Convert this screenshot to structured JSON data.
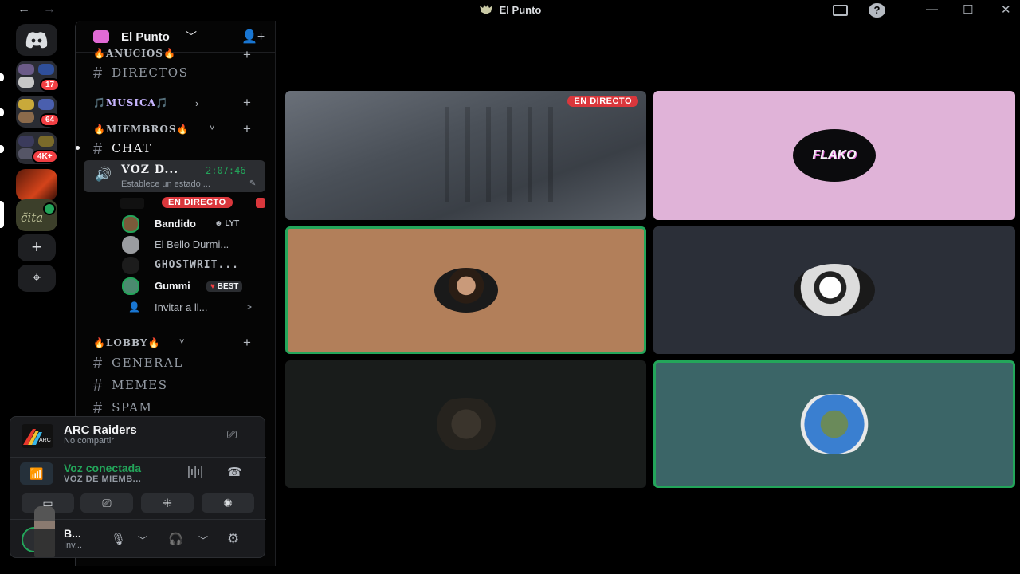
{
  "window": {
    "title": "El Punto",
    "back_icon": "arrow-left-icon",
    "forward_icon": "arrow-right-icon",
    "minimize_glyph": "—",
    "maximize_glyph": "☐",
    "close_glyph": "✕",
    "help_glyph": "?"
  },
  "rail": {
    "badges": [
      "17",
      "64",
      "4K+"
    ],
    "add_glyph": "+",
    "explore_glyph": "⌖"
  },
  "server": {
    "name": "El Punto",
    "chevron": "﹀"
  },
  "categories": [
    {
      "label": "🔥ANUCIOS🔥",
      "chevron": "˅",
      "plus": "+"
    },
    {
      "label": "🎵MUSICA🎵",
      "chevron": "›",
      "plus": "+"
    },
    {
      "label": "🔥MIEMBROS🔥",
      "chevron": "˅",
      "plus": "+"
    },
    {
      "label": "🔥LOBBY🔥",
      "chevron": "˅",
      "plus": "+"
    }
  ],
  "channels": {
    "hash": "#",
    "directos": "DIRECTOS",
    "chat": "CHAT",
    "general": "GENERAL",
    "memes": "MEMES",
    "spam": "SPAM"
  },
  "voice_channel": {
    "name": "VOZ D...",
    "elapsed": "2:07:46",
    "status_placeholder": "Establece un estado ...",
    "live_label": "EN DIRECTO",
    "users": [
      {
        "name": "Bandido",
        "badge": "LYT"
      },
      {
        "name": "El Bello Durmi..."
      },
      {
        "name": "GHOSTWRIT..."
      },
      {
        "name": "Gummi",
        "badge": "BEST"
      }
    ],
    "invite": "Invitar a ll...",
    "invite_chevron": ">"
  },
  "panel": {
    "activity_title": "ARC Raiders",
    "activity_sub": "No compartir",
    "rtc_title": "Voz conectada",
    "rtc_sub": "VOZ DE MIEMB...",
    "user_name": "B...",
    "user_sub": "Inv..."
  },
  "stage": {
    "live_label": "EN DIRECTO",
    "flako_text": "FLAKO"
  },
  "colors": {
    "online_green": "#23a55a",
    "live_red": "#da373c",
    "tile_pink": "#e0b3d8",
    "tile_tan": "#b27f5a",
    "tile_slate": "#2b2f38",
    "tile_dark": "#191c1b",
    "tile_teal": "#3b6567"
  }
}
